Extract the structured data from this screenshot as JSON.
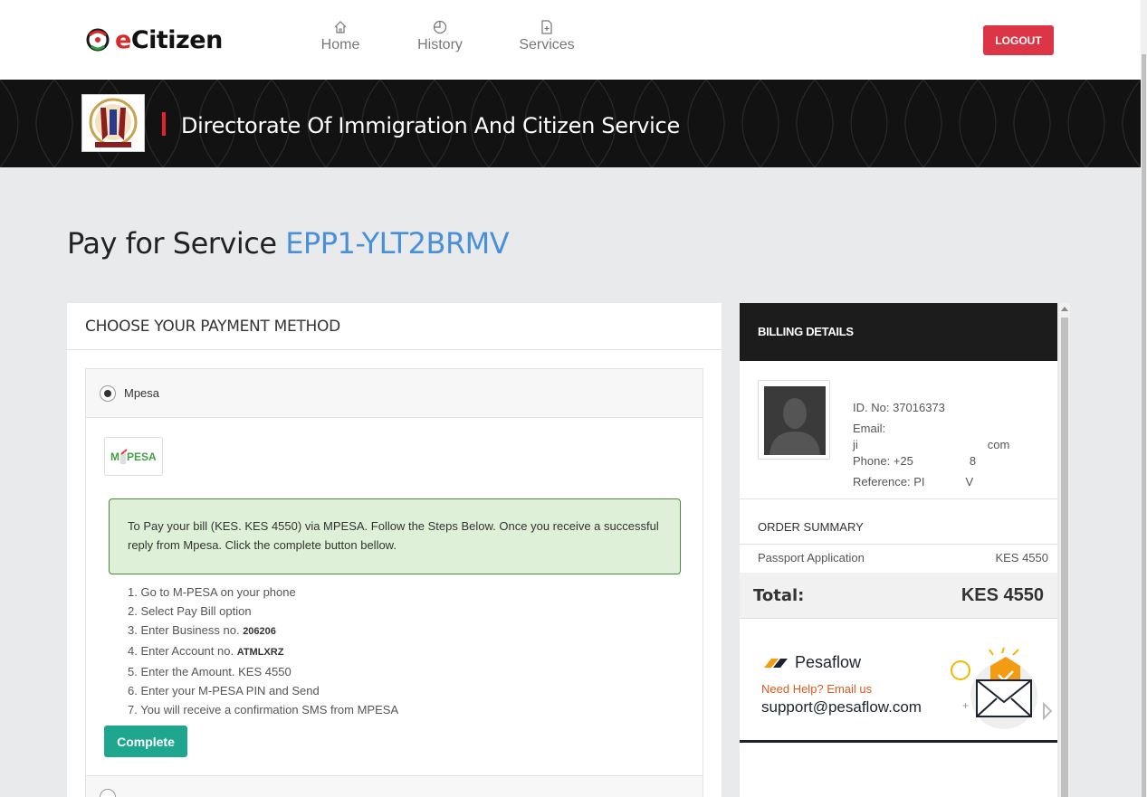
{
  "nav": {
    "logo_e": "e",
    "logo_rest": "Citizen",
    "home": "Home",
    "history": "History",
    "services": "Services",
    "logout": "LOGOUT"
  },
  "banner": {
    "title": "Directorate Of Immigration And Citizen Service"
  },
  "page": {
    "title_prefix": "Pay for Service",
    "reference": "EPP1-YLT2BRMV"
  },
  "payment": {
    "header": "CHOOSE YOUR PAYMENT METHOD",
    "method_label": "Mpesa",
    "mpesa_logo": "M-PESA",
    "instruction": "To Pay your bill (KES. KES 4550) via MPESA. Follow the Steps Below. Once you receive a successful reply from Mpesa. Click the complete button bellow.",
    "steps": [
      {
        "text": "1. Go to M-PESA on your phone",
        "bold": ""
      },
      {
        "text": "2. Select Pay Bill option",
        "bold": ""
      },
      {
        "text": "3. Enter Business no. ",
        "bold": "206206"
      },
      {
        "text": "4. Enter Account no. ",
        "bold": "ATMLXRZ"
      },
      {
        "text": "5. Enter the Amount. KES 4550",
        "bold": ""
      },
      {
        "text": "6. Enter your M-PESA PIN and Send",
        "bold": ""
      },
      {
        "text": "7. You will receive a confirmation SMS from MPESA",
        "bold": ""
      }
    ],
    "complete_label": "Complete"
  },
  "billing": {
    "header": "BILLING DETAILS",
    "id_no": "ID. No: 37016373",
    "email_label": "Email:",
    "email_start": "ji",
    "email_end": "com",
    "phone_start": "Phone: +25",
    "phone_end": "8",
    "reference_start": "Reference: PI",
    "reference_end": "V",
    "order_summary_title": "ORDER SUMMARY",
    "order_item": "Passport Application",
    "order_amount": "KES 4550",
    "total_label": "Total:",
    "total_amount": "KES 4550"
  },
  "help": {
    "brand": "Pesaflow",
    "need_help": "Need Help? Email us",
    "email": "support@pesaflow.com"
  },
  "colors": {
    "accent_blue": "#4a90d9",
    "logout_red": "#dc3545",
    "complete_green": "#1fa68f",
    "alert_bg": "#def0d8",
    "help_orange": "#e05a1c"
  }
}
